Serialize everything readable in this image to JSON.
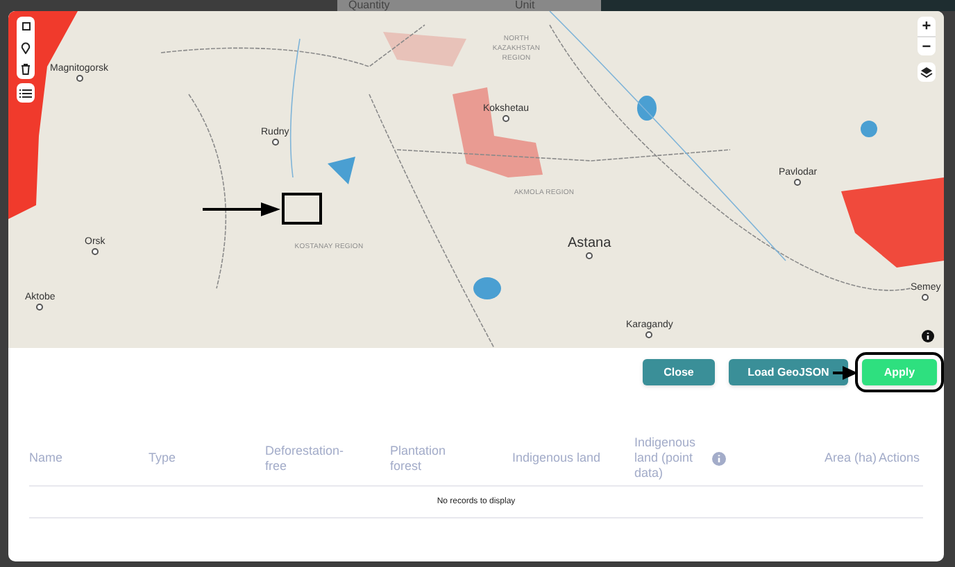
{
  "background_header": {
    "columns": [
      "Quantity",
      "Unit"
    ]
  },
  "map": {
    "labels": [
      {
        "text": "Magnitogorsk",
        "kind": "city"
      },
      {
        "text": "Rudny",
        "kind": "city"
      },
      {
        "text": "Orsk",
        "kind": "city"
      },
      {
        "text": "Aktobe",
        "kind": "city"
      },
      {
        "text": "KOSTANAY REGION",
        "kind": "region"
      },
      {
        "text": "NORTH KAZAKHSTAN REGION",
        "kind": "region"
      },
      {
        "text": "Kokshetau",
        "kind": "city"
      },
      {
        "text": "AKMOLA REGION",
        "kind": "region"
      },
      {
        "text": "Astana",
        "kind": "capital"
      },
      {
        "text": "Pavlodar",
        "kind": "city"
      },
      {
        "text": "Karagandy",
        "kind": "city"
      },
      {
        "text": "Semey",
        "kind": "city"
      }
    ],
    "zoom_in": "+",
    "zoom_out": "−"
  },
  "buttons": [
    {
      "label": "Close",
      "kind": "secondary"
    },
    {
      "label": "Load GeoJSON",
      "kind": "secondary"
    },
    {
      "label": "Apply",
      "kind": "primary"
    }
  ],
  "table": {
    "columns": [
      "Name",
      "Type",
      "Deforestation-free",
      "Plantation forest",
      "Indigenous land",
      "Indigenous land (point data)",
      "Area (ha)",
      "Actions"
    ],
    "empty_message": "No records to display"
  }
}
